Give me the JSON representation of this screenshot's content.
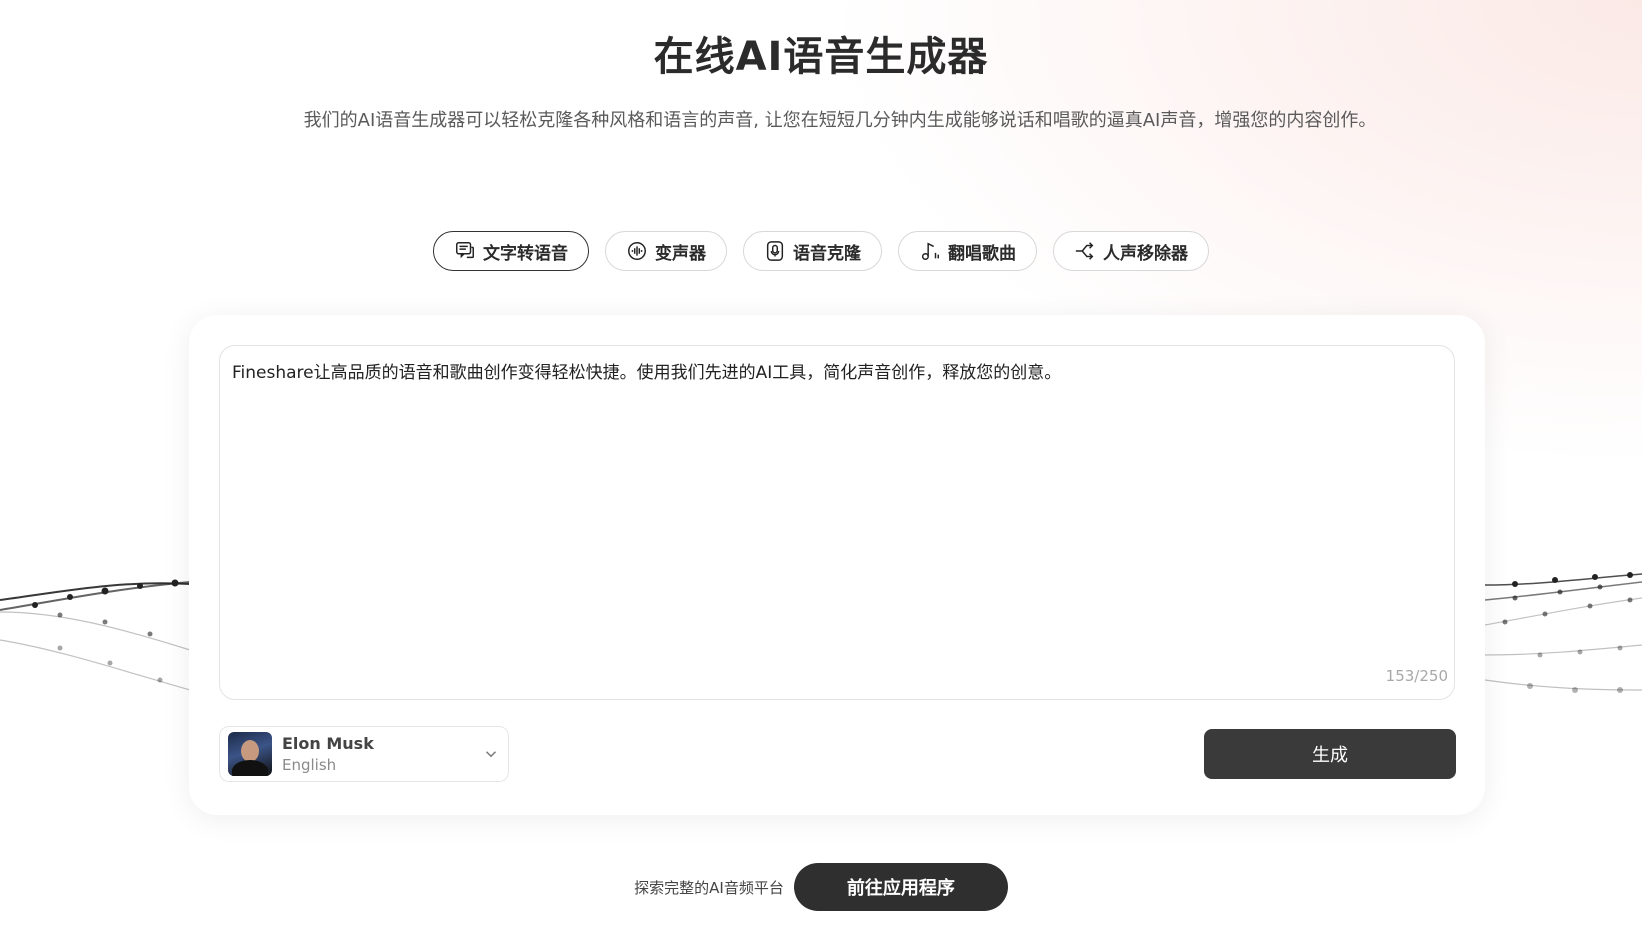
{
  "page": {
    "title": "在线AI语音生成器",
    "subtitle": "我们的AI语音生成器可以轻松克隆各种风格和语言的声音, 让您在短短几分钟内生成能够说话和唱歌的逼真AI声音，增强您的内容创作。"
  },
  "tabs": [
    {
      "label": "文字转语音",
      "icon": "chat-bubble-icon",
      "active": true
    },
    {
      "label": "变声器",
      "icon": "soundwave-icon",
      "active": false
    },
    {
      "label": "语音克隆",
      "icon": "microphone-icon",
      "active": false
    },
    {
      "label": "翻唱歌曲",
      "icon": "music-note-icon",
      "active": false
    },
    {
      "label": "人声移除器",
      "icon": "split-icon",
      "active": false
    }
  ],
  "editor": {
    "text": "Fineshare让高品质的语音和歌曲创作变得轻松快捷。使用我们先进的AI工具，简化声音创作，释放您的创意。",
    "counter": "153/250"
  },
  "voice": {
    "name": "Elon Musk",
    "language": "English"
  },
  "actions": {
    "generate_label": "生成"
  },
  "footer": {
    "text": "探索完整的AI音频平台",
    "button_label": "前往应用程序"
  }
}
